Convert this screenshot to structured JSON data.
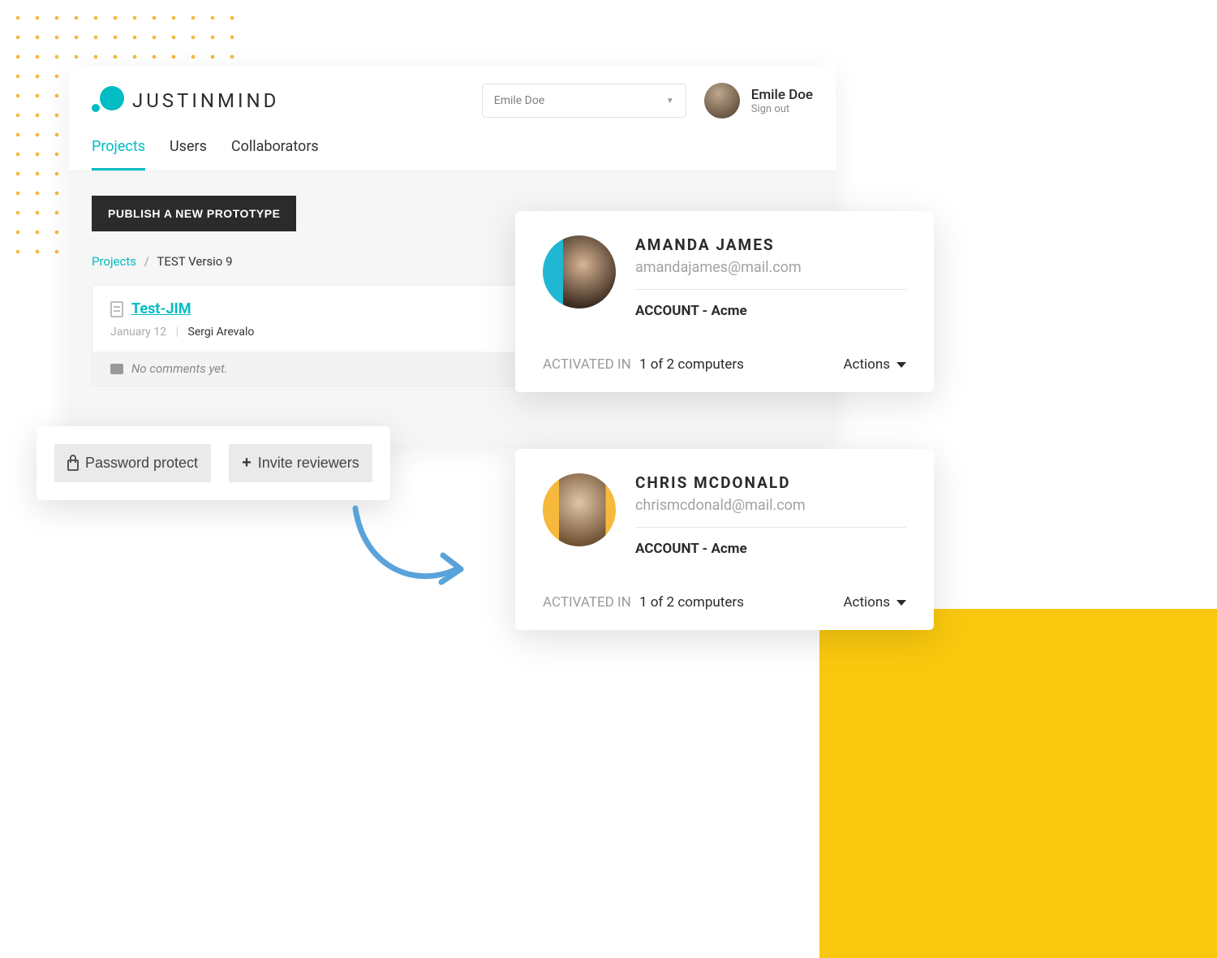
{
  "brand": {
    "name": "JUSTINMIND"
  },
  "header": {
    "select_value": "Emile Doe",
    "user_name": "Emile Doe",
    "sign_out": "Sign out"
  },
  "tabs": [
    "Projects",
    "Users",
    "Collaborators"
  ],
  "content": {
    "publish_label": "PUBLISH A NEW PROTOTYPE",
    "breadcrumb": {
      "root": "Projects",
      "current": "TEST Versio 9"
    },
    "prototype": {
      "title": "Test-JIM",
      "date": "January 12",
      "author": "Sergi Arevalo",
      "comments": "No comments yet."
    }
  },
  "actions": {
    "password_protect": "Password protect",
    "invite_reviewers": "Invite reviewers"
  },
  "user_cards": [
    {
      "name": "AMANDA JAMES",
      "email": "amandajames@mail.com",
      "account": "ACCOUNT - Acme",
      "activated_label": "ACTIVATED IN",
      "activated_value": "1 of 2 computers",
      "actions_label": "Actions"
    },
    {
      "name": "CHRIS MCDONALD",
      "email": "chrismcdonald@mail.com",
      "account": "ACCOUNT - Acme",
      "activated_label": "ACTIVATED IN",
      "activated_value": "1 of 2 computers",
      "actions_label": "Actions"
    }
  ]
}
